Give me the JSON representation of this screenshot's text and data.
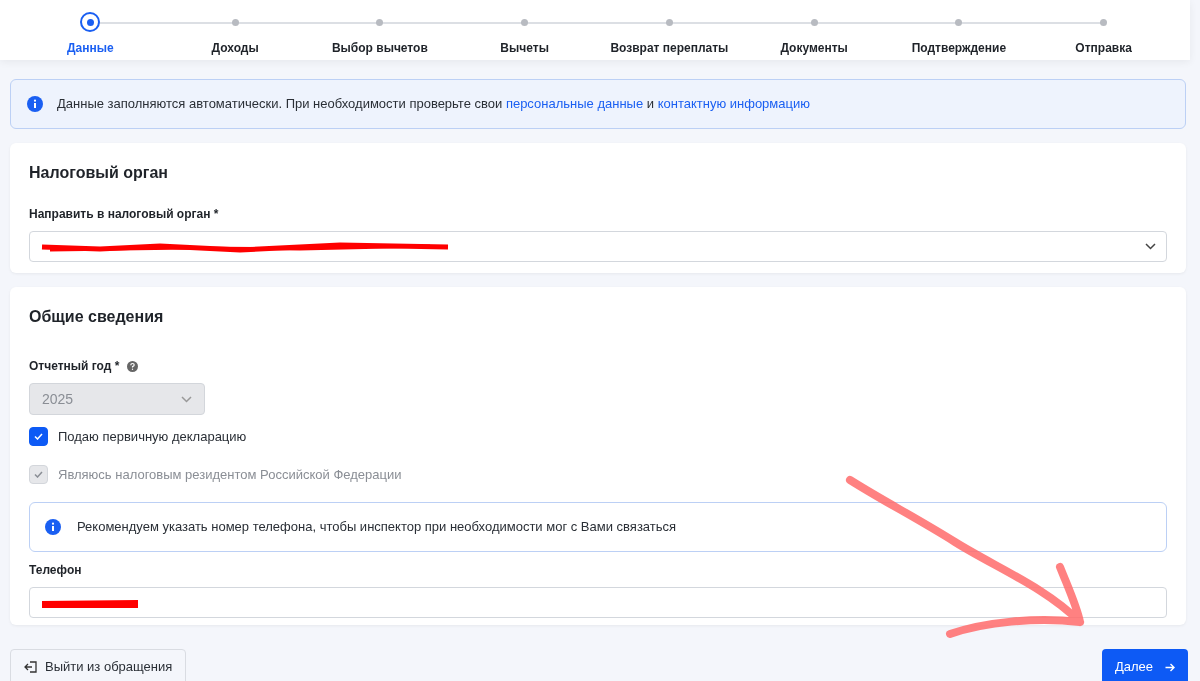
{
  "steps": [
    {
      "label": "Данные",
      "selected": true
    },
    {
      "label": "Доходы",
      "selected": false
    },
    {
      "label": "Выбор вычетов",
      "selected": false
    },
    {
      "label": "Вычеты",
      "selected": false
    },
    {
      "label": "Возврат переплаты",
      "selected": false
    },
    {
      "label": "Документы",
      "selected": false
    },
    {
      "label": "Подтверждение",
      "selected": false
    },
    {
      "label": "Отправка",
      "selected": false
    }
  ],
  "notice": {
    "text": "Данные заполняются автоматически. При необходимости проверьте свои",
    "link_1": "персональные данные",
    "joiner": "и",
    "link_2": "контактную информацию"
  },
  "tax_office": {
    "title": "Налоговый орган",
    "field_label": "Направить в налоговый орган *"
  },
  "general": {
    "title": "Общие сведения",
    "year_label": "Отчетный год *",
    "year_value": "2025",
    "checkboxes": [
      {
        "label": "Подаю первичную декларацию",
        "checked": true,
        "disabled": false
      },
      {
        "label": "Являюсь налоговым резидентом Российской Федерации",
        "checked": true,
        "disabled": true
      }
    ],
    "phone_hint": "Рекомендуем указать номер телефона, чтобы инспектор при необходимости мог с Вами связаться",
    "phone_label": "Телефон"
  },
  "buttons": {
    "exit": "Выйти из обращения",
    "next": "Далее"
  }
}
